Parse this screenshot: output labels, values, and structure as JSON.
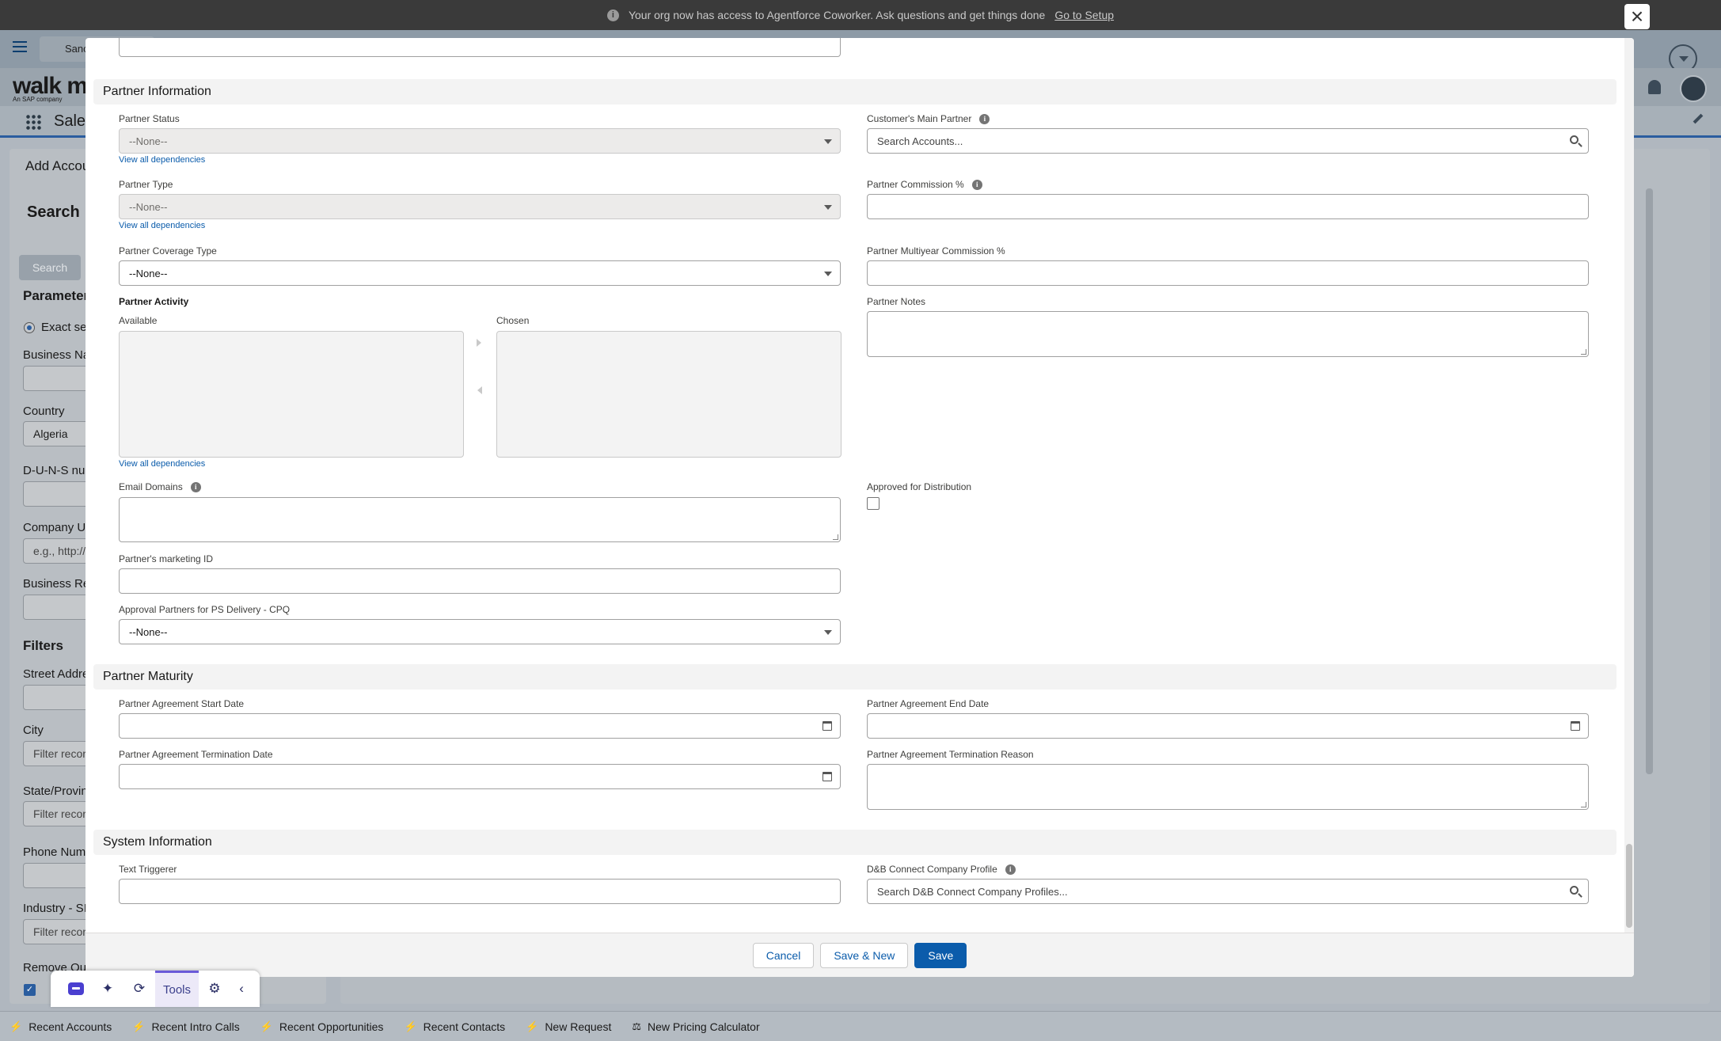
{
  "banner": {
    "message": "Your org now has access to Agentforce Coworker. Ask questions and get things done",
    "link": "Go to Setup",
    "info_glyph": "i",
    "close_glyph": "×"
  },
  "background": {
    "tab_label": "Sanc",
    "logo": "walk m",
    "logo_sub": "An SAP company",
    "app_name": "Sales",
    "panel_title": "Add Accou",
    "search_title": "Search",
    "search_button": "Search",
    "parameters_label": "Parameter",
    "exact_search": "Exact se",
    "business_name": "Business Na",
    "country_label": "Country",
    "country_value": "Algeria",
    "duns_label": "D-U-N-S nu",
    "company_url_label": "Company UF",
    "company_url_placeholder": "e.g., http://",
    "business_reg_label": "Business Re",
    "filters_label": "Filters",
    "street_label": "Street Addre",
    "city_label": "City",
    "city_placeholder": "Filter recor",
    "state_label": "State/Provin",
    "state_placeholder": "Filter recor",
    "phone_label": "Phone Numb",
    "industry_label": "Industry - SI",
    "industry_placeholder": "Filter recor",
    "remove_label": "Remove Out"
  },
  "walkme_toolbar": {
    "tools_label": "Tools"
  },
  "utility_bar": {
    "items": [
      "Recent Accounts",
      "Recent Intro Calls",
      "Recent Opportunities",
      "Recent Contacts",
      "New Request",
      "New Pricing Calculator"
    ]
  },
  "modal": {
    "sections": {
      "partner_information": "Partner Information",
      "partner_maturity": "Partner Maturity",
      "system_information": "System Information"
    },
    "fields": {
      "partner_status": {
        "label": "Partner Status",
        "value": "--None--"
      },
      "customers_main_partner": {
        "label": "Customer's Main Partner",
        "placeholder": "Search Accounts..."
      },
      "partner_type": {
        "label": "Partner Type",
        "value": "--None--"
      },
      "partner_commission": {
        "label": "Partner Commission %"
      },
      "partner_coverage_type": {
        "label": "Partner Coverage Type",
        "value": "--None--"
      },
      "partner_multiyear_commission": {
        "label": "Partner Multiyear Commission %"
      },
      "partner_activity": {
        "label": "Partner Activity",
        "available": "Available",
        "chosen": "Chosen"
      },
      "partner_notes": {
        "label": "Partner Notes"
      },
      "email_domains": {
        "label": "Email Domains"
      },
      "approved_for_distribution": {
        "label": "Approved for Distribution"
      },
      "partners_marketing_id": {
        "label": "Partner's marketing ID"
      },
      "approval_partners_ps": {
        "label": "Approval Partners for PS Delivery - CPQ",
        "value": "--None--"
      },
      "agreement_start_date": {
        "label": "Partner Agreement Start Date"
      },
      "agreement_end_date": {
        "label": "Partner Agreement End Date"
      },
      "agreement_termination_date": {
        "label": "Partner Agreement Termination Date"
      },
      "agreement_termination_reason": {
        "label": "Partner Agreement Termination Reason"
      },
      "text_triggerer": {
        "label": "Text Triggerer"
      },
      "dnb_profile": {
        "label": "D&B Connect Company Profile",
        "placeholder": "Search D&B Connect Company Profiles..."
      }
    },
    "view_all_dependencies": "View all dependencies",
    "footer": {
      "cancel": "Cancel",
      "save_new": "Save & New",
      "save": "Save"
    }
  }
}
